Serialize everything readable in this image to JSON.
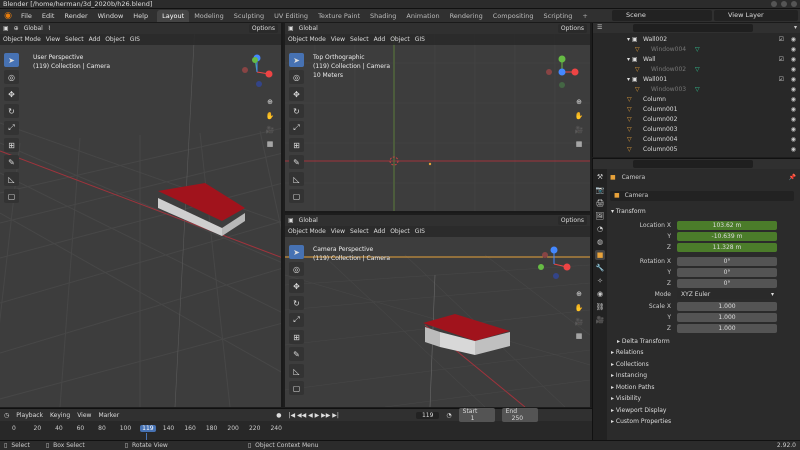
{
  "window_title": "Blender [/home/herman/3d_2020b/h26.blend]",
  "menu": [
    "File",
    "Edit",
    "Render",
    "Window",
    "Help"
  ],
  "workspaces": [
    "Layout",
    "Modeling",
    "Sculpting",
    "UV Editing",
    "Texture Paint",
    "Shading",
    "Animation",
    "Rendering",
    "Compositing",
    "Scripting"
  ],
  "active_workspace": "Layout",
  "scene": "Scene",
  "view_layer": "View Layer",
  "viewport_header": {
    "orientation": "Global",
    "options": "Options",
    "mode": "Object Mode",
    "menus": [
      "View",
      "Select",
      "Add",
      "Object",
      "GIS"
    ]
  },
  "viewports": [
    {
      "name": "User Perspective",
      "collection": "(119) Collection | Camera",
      "extra": ""
    },
    {
      "name": "Top Orthographic",
      "collection": "(119) Collection | Camera",
      "extra": "10 Meters"
    },
    {
      "name": "Camera Perspective",
      "collection": "(119) Collection | Camera",
      "extra": ""
    }
  ],
  "outliner": {
    "rows": [
      {
        "label": "Wall002",
        "indent": 1,
        "type": "collection"
      },
      {
        "label": "Window004",
        "indent": 2,
        "type": "object-dim"
      },
      {
        "label": "Wall",
        "indent": 1,
        "type": "collection"
      },
      {
        "label": "Window002",
        "indent": 2,
        "type": "object-dim"
      },
      {
        "label": "Wall001",
        "indent": 1,
        "type": "collection"
      },
      {
        "label": "Window003",
        "indent": 2,
        "type": "object-dim"
      },
      {
        "label": "Column",
        "indent": 1,
        "type": "object"
      },
      {
        "label": "Column001",
        "indent": 1,
        "type": "object"
      },
      {
        "label": "Column002",
        "indent": 1,
        "type": "object"
      },
      {
        "label": "Column003",
        "indent": 1,
        "type": "object"
      },
      {
        "label": "Column004",
        "indent": 1,
        "type": "object"
      },
      {
        "label": "Column005",
        "indent": 1,
        "type": "object"
      }
    ]
  },
  "properties": {
    "object_name": "Camera",
    "data_name": "Camera",
    "transform_label": "Transform",
    "location": {
      "label": "Location X",
      "x": "103.62 m",
      "y": "-10.639 m",
      "z": "11.328 m"
    },
    "rotation": {
      "label": "Rotation X",
      "x": "0°",
      "y": "0°",
      "z": "0°"
    },
    "mode_label": "Mode",
    "mode_value": "XYZ Euler",
    "scale": {
      "label": "Scale X",
      "x": "1.000",
      "y": "1.000",
      "z": "1.000"
    },
    "delta": "Delta Transform",
    "sections": [
      "Relations",
      "Collections",
      "Instancing",
      "Motion Paths",
      "Visibility",
      "Viewport Display",
      "Custom Properties"
    ]
  },
  "timeline": {
    "menus": [
      "Playback",
      "Keying",
      "View",
      "Marker"
    ],
    "current_frame": "119",
    "start_label": "Start",
    "start": "1",
    "end_label": "End",
    "end": "250",
    "ticks": [
      "0",
      "20",
      "40",
      "60",
      "80",
      "100",
      "119",
      "140",
      "160",
      "180",
      "200",
      "220",
      "240"
    ]
  },
  "status": {
    "select": "Select",
    "box_select": "Box Select",
    "rotate_view": "Rotate View",
    "context_menu": "Object Context Menu",
    "version": "2.92.0"
  },
  "colors": {
    "accent": "#4772b3",
    "field_green": "#4b7c2a",
    "orange": "#e87d0d",
    "roof": "#a1131c"
  }
}
